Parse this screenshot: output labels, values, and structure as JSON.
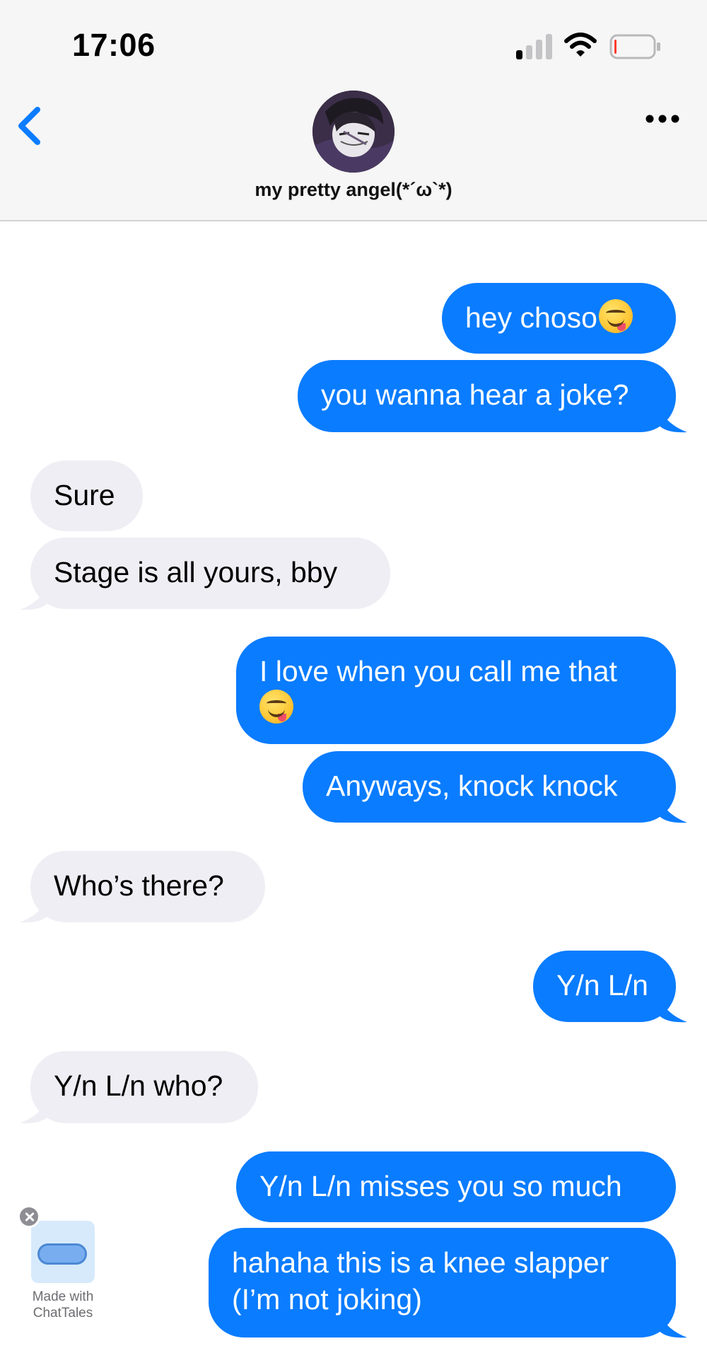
{
  "status_bar": {
    "time": "17:06",
    "signal_icon": "cellular-signal-icon",
    "wifi_icon": "wifi-icon",
    "battery_icon": "battery-low-icon",
    "battery_level": 0.05
  },
  "header": {
    "back_icon": "chevron-left-icon",
    "more_icon": "ellipsis-icon",
    "contact_name": "my pretty angel(*´ω`*)",
    "avatar_icon": "contact-avatar"
  },
  "colors": {
    "sent_bubble": "#0a7cff",
    "received_bubble": "#efeef4",
    "accent": "#0a7cff"
  },
  "messages": [
    {
      "direction": "sent",
      "text": "hey choso",
      "emoji": "face-savoring-food"
    },
    {
      "direction": "sent",
      "text": "you wanna hear a joke?"
    },
    {
      "direction": "received",
      "text": "Sure"
    },
    {
      "direction": "received",
      "text": "Stage is all yours, bby"
    },
    {
      "direction": "sent",
      "text": "I love when you call me that",
      "emoji": "face-savoring-food"
    },
    {
      "direction": "sent",
      "text": "Anyways, knock knock"
    },
    {
      "direction": "received",
      "text": "Who’s there?"
    },
    {
      "direction": "sent",
      "text": "Y/n L/n"
    },
    {
      "direction": "received",
      "text": "Y/n L/n who?"
    },
    {
      "direction": "sent",
      "text": "Y/n L/n misses you so much"
    },
    {
      "direction": "sent",
      "text": "hahaha this is a knee slapper (I’m not joking)"
    }
  ],
  "watermark": {
    "close_icon": "close-circle-icon",
    "logo_icon": "chat-bubble-logo-icon",
    "line1": "Made with",
    "line2": "ChatTales"
  }
}
